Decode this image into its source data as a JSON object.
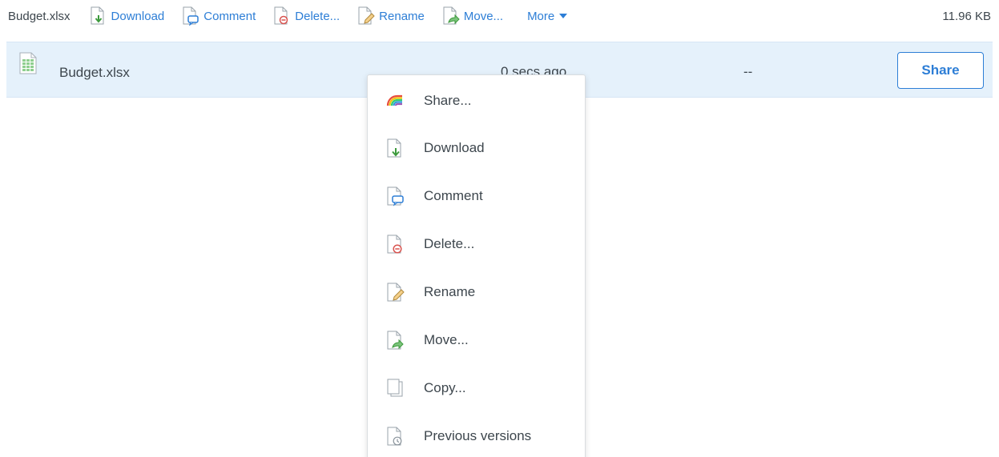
{
  "toolbar": {
    "filename": "Budget.xlsx",
    "actions": [
      {
        "label": "Download",
        "icon": "download-icon"
      },
      {
        "label": "Comment",
        "icon": "comment-icon"
      },
      {
        "label": "Delete...",
        "icon": "delete-icon"
      },
      {
        "label": "Rename",
        "icon": "rename-icon"
      },
      {
        "label": "Move...",
        "icon": "move-icon"
      }
    ],
    "more_label": "More",
    "file_size": "11.96 KB"
  },
  "file_row": {
    "name": "Budget.xlsx",
    "modified": "0 secs ago",
    "shared_with": "--",
    "share_label": "Share",
    "icon": "spreadsheet-file-icon"
  },
  "context_menu": {
    "items": [
      {
        "label": "Share...",
        "icon": "share-rainbow-icon"
      },
      {
        "label": "Download",
        "icon": "download-icon"
      },
      {
        "label": "Comment",
        "icon": "comment-icon"
      },
      {
        "label": "Delete...",
        "icon": "delete-icon"
      },
      {
        "label": "Rename",
        "icon": "rename-icon"
      },
      {
        "label": "Move...",
        "icon": "move-icon"
      },
      {
        "label": "Copy...",
        "icon": "copy-icon"
      },
      {
        "label": "Previous versions",
        "icon": "previous-versions-icon"
      }
    ]
  },
  "colors": {
    "accent": "#2d7ed6",
    "row_selected": "#e5f1fb",
    "text": "#3d464d"
  }
}
